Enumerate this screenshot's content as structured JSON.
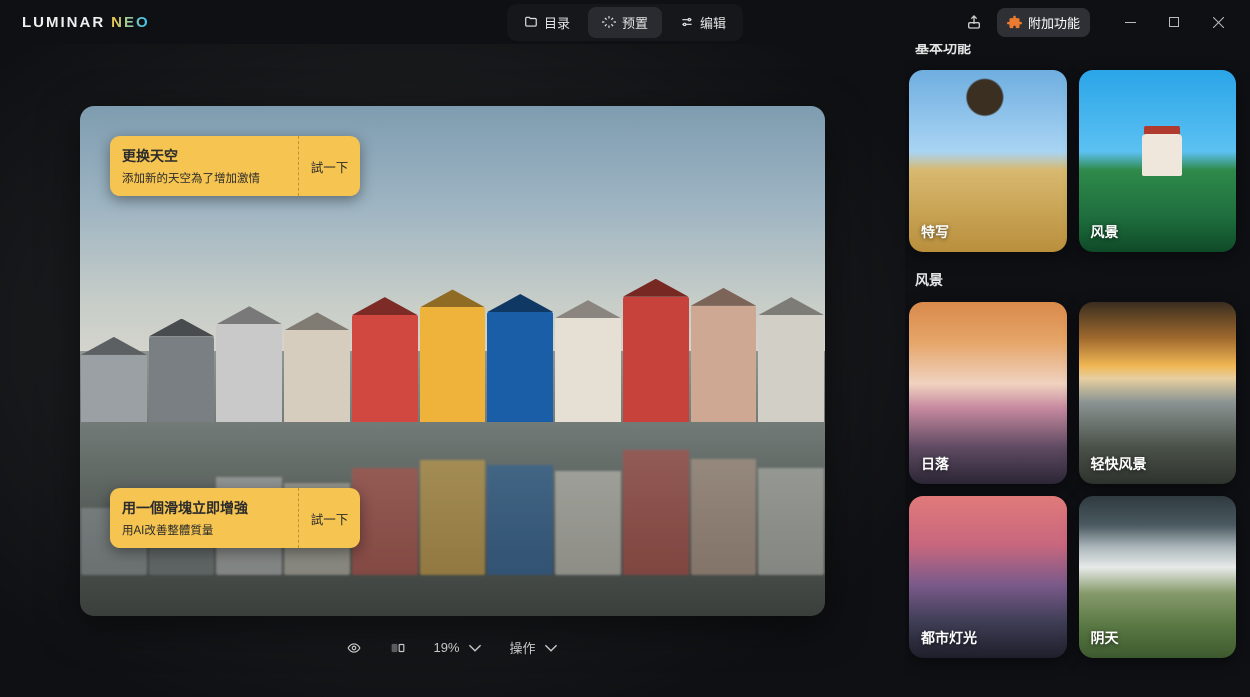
{
  "app": {
    "logo_word1": "LUMINAR",
    "logo_word2": "NEO"
  },
  "tabs": {
    "catalog": "目录",
    "presets": "预置",
    "edit": "编辑"
  },
  "titlebar": {
    "addon_label": "附加功能"
  },
  "tips": {
    "sky": {
      "title": "更换天空",
      "subtitle": "添加新的天空為了增加激情",
      "action": "試一下"
    },
    "enhance": {
      "title": "用一個滑塊立即增強",
      "subtitle": "用AI改善整體質量",
      "action": "試一下"
    }
  },
  "toolbar": {
    "zoom": "19%",
    "actions_label": "操作"
  },
  "presets": {
    "section1_title": "基本功能",
    "section2_title": "风景",
    "cards": {
      "portrait": "特写",
      "landscape": "风景",
      "sunset": "日落",
      "easy_landscape": "轻快风景",
      "city_lights": "都市灯光",
      "overcast": "阴天"
    }
  }
}
